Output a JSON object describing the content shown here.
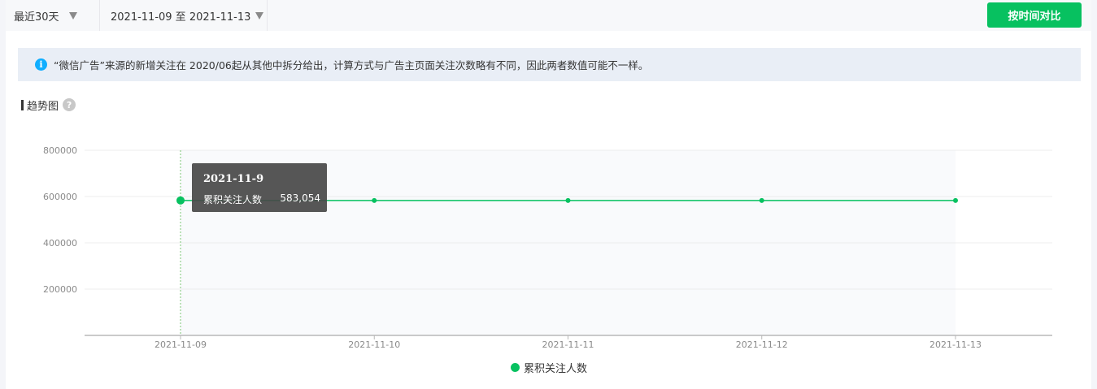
{
  "toolbar": {
    "range_label": "最近30天",
    "date_range": "2021-11-09 至 2021-11-13",
    "compare_button": "按时间对比"
  },
  "notice": {
    "icon": "info-icon",
    "text": "“微信广告”来源的新增关注在 2020/06起从其他中拆分给出，计算方式与广告主页面关注次数略有不同，因此两者数值可能不一样。"
  },
  "section": {
    "title": "趋势图",
    "help_icon": "question-icon"
  },
  "tooltip": {
    "title": "2021-11-9",
    "series_name": "累积关注人数",
    "value": "583,054"
  },
  "colors": {
    "accent": "#07c160",
    "info": "#10aeff",
    "notice_bg": "#e9eef6"
  },
  "chart_data": {
    "type": "line",
    "title": "",
    "xlabel": "",
    "ylabel": "",
    "categories": [
      "2021-11-09",
      "2021-11-10",
      "2021-11-11",
      "2021-11-12",
      "2021-11-13"
    ],
    "series": [
      {
        "name": "累积关注人数",
        "values": [
          583054,
          583000,
          582900,
          583100,
          583000
        ]
      }
    ],
    "y_ticks": [
      "200000",
      "400000",
      "600000",
      "800000"
    ],
    "ylim": [
      0,
      800000
    ],
    "grid": true,
    "legend": "bottom-center",
    "highlight_index": 0
  }
}
